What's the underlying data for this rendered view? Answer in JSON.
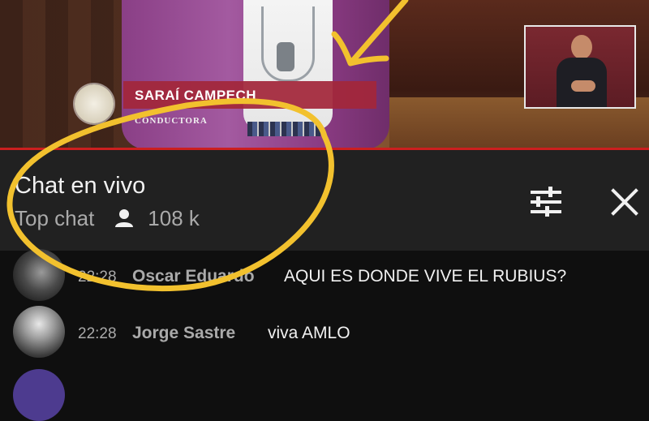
{
  "video": {
    "name_plate": "SARAÍ CAMPECH",
    "role": "CONDUCTORA"
  },
  "chat": {
    "title": "Chat en vivo",
    "mode": "Top chat",
    "viewer_count": "108 k",
    "icons": [
      "person-icon",
      "tune-icon",
      "close-icon"
    ]
  },
  "messages": [
    {
      "time": "22:28",
      "author": "Oscar Eduardo",
      "text": "AQUI ES DONDE VIVE EL RUBIUS?"
    },
    {
      "time": "22:28",
      "author": "Jorge Sastre",
      "text": "viva AMLO"
    }
  ],
  "colors": {
    "chat_header_bg": "#212121",
    "messages_bg": "#0f0f0f",
    "progress_red": "#cc1f1f",
    "annotation_yellow": "#f2c12e",
    "name_plate_red": "#a3273a"
  }
}
